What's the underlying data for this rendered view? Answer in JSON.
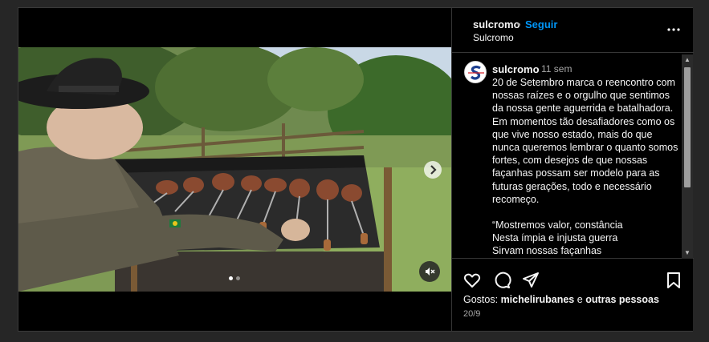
{
  "post": {
    "username": "sulcromo",
    "separator": "•",
    "follow_label": "Seguir",
    "subtitle": "Sulcromo",
    "more_icon": "more-horizontal-icon"
  },
  "caption": {
    "username": "sulcromo",
    "time_ago": "11 sem",
    "paragraph_1": "20 de Setembro marca o reencontro com nossas raízes e o orgulho que sentimos da nossa gente aguerrida e batalhadora. Em momentos tão desafiadores como os que vive nosso estado, mais do que nunca queremos lembrar o quanto somos fortes, com desejos de que nossas façanhas possam ser modelo para as futuras gerações, todo e necessário recomeço.",
    "paragraph_2": "“Mostremos valor, constância\nNesta ímpia e injusta guerra\nSirvam nossas façanhas"
  },
  "media": {
    "next_icon": "chevron-right-icon",
    "mute_icon": "speaker-muted-icon",
    "carousel_count": 2,
    "carousel_active": 0
  },
  "actions": {
    "icons": [
      "heart-icon",
      "comment-icon",
      "share-icon",
      "bookmark-icon"
    ],
    "likes_prefix": "Gostos:",
    "likes_user": "michelirubanes",
    "likes_connector": "e",
    "likes_others": "outras pessoas",
    "date": "20/9"
  },
  "colors": {
    "background": "#000000",
    "link_blue": "#0095f6",
    "muted_text": "#a8a8a8",
    "brand_red": "#d3202a",
    "brand_blue": "#1d3f8f"
  }
}
